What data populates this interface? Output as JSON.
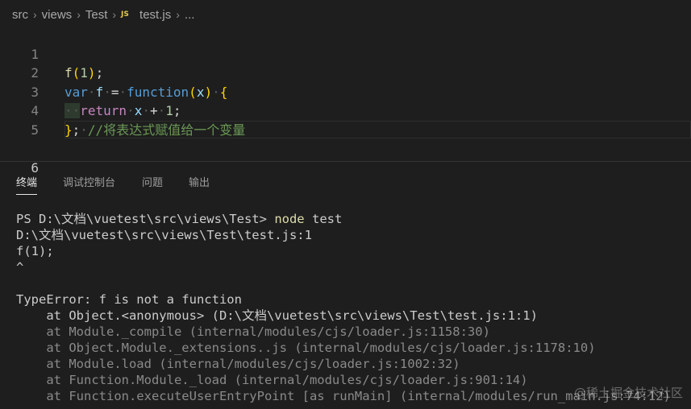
{
  "breadcrumb": {
    "items": [
      "src",
      "views",
      "Test"
    ],
    "file_badge": "JS",
    "file_name": "test.js",
    "more": "..."
  },
  "editor": {
    "line_numbers": [
      "1",
      "2",
      "3",
      "4",
      "5",
      "6"
    ],
    "line1": {
      "fn": "f",
      "open": "(",
      "num": "1",
      "close": ")",
      "semi": ";"
    },
    "line2": {
      "kw": "var",
      "name": "f",
      "eq": "=",
      "function_kw": "function",
      "open": "(",
      "param": "x",
      "close": ")",
      "brace": "{"
    },
    "line3": {
      "indent": "··",
      "ret": "return",
      "x": "x",
      "plus": "+",
      "num": "1",
      "semi": ";"
    },
    "line4": {
      "brace": "}",
      "semi": ";",
      "comment": "//将表达式赋值给一个变量"
    }
  },
  "panel": {
    "tabs": [
      "终端",
      "调试控制台",
      "问题",
      "输出"
    ]
  },
  "terminal": {
    "prompt": "PS D:\\文档\\vuetest\\src\\views\\Test>",
    "cmd": "node",
    "cmd_arg": "test",
    "lines": [
      "D:\\文档\\vuetest\\src\\views\\Test\\test.js:1",
      "f(1);",
      "^",
      "",
      "TypeError: f is not a function",
      "    at Object.<anonymous> (D:\\文档\\vuetest\\src\\views\\Test\\test.js:1:1)"
    ],
    "dim_lines": [
      "    at Module._compile (internal/modules/cjs/loader.js:1158:30)",
      "    at Object.Module._extensions..js (internal/modules/cjs/loader.js:1178:10)",
      "    at Module.load (internal/modules/cjs/loader.js:1002:32)",
      "    at Function.Module._load (internal/modules/cjs/loader.js:901:14)",
      "    at Function.executeUserEntryPoint [as runMain] (internal/modules/run_main.js:74:12)"
    ]
  },
  "watermark": "@稀土掘金技术社区"
}
